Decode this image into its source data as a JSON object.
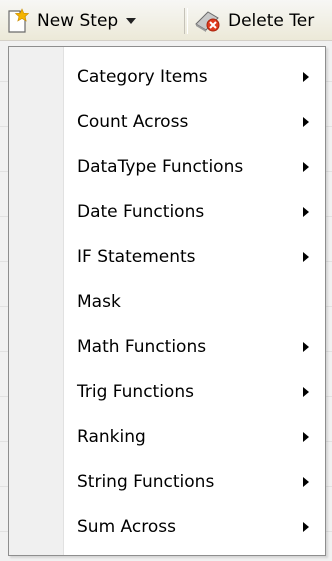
{
  "toolbar": {
    "new_step_label": "New Step",
    "delete_label": "Delete Ter"
  },
  "menu": {
    "items": [
      {
        "label": "Category Items",
        "has_submenu": true
      },
      {
        "label": "Count Across",
        "has_submenu": true
      },
      {
        "label": "DataType Functions",
        "has_submenu": true
      },
      {
        "label": "Date Functions",
        "has_submenu": true
      },
      {
        "label": "IF Statements",
        "has_submenu": true
      },
      {
        "label": "Mask",
        "has_submenu": false
      },
      {
        "label": "Math Functions",
        "has_submenu": true
      },
      {
        "label": "Trig Functions",
        "has_submenu": true
      },
      {
        "label": "Ranking",
        "has_submenu": true
      },
      {
        "label": "String Functions",
        "has_submenu": true
      },
      {
        "label": "Sum Across",
        "has_submenu": true
      }
    ]
  },
  "icons": {
    "new_step": "new-document-star-icon",
    "delete": "delete-eraser-icon",
    "dropdown": "chevron-down-icon",
    "submenu": "chevron-right-icon"
  }
}
